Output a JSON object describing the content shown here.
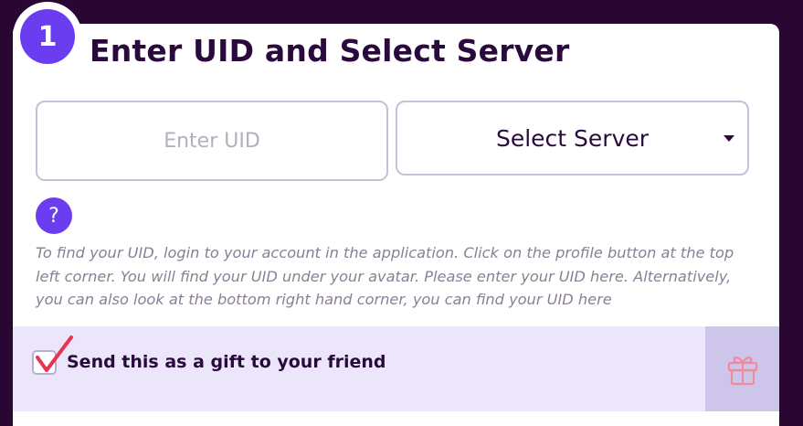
{
  "step": {
    "number": "1",
    "title": "Enter UID and Select Server"
  },
  "uid_field": {
    "value": "",
    "placeholder": "Enter UID"
  },
  "server_select": {
    "label": "Select Server"
  },
  "help": {
    "icon_label": "?",
    "text": "To find your UID, login to your account in the application. Click on the profile button at the top left corner. You will find your UID under your avatar. Please enter your UID here. Alternatively, you can also look at the bottom right hand corner, you can find your UID here"
  },
  "gift": {
    "label": "Send this as a gift to your friend",
    "checked": true,
    "icon": "gift-icon"
  },
  "colors": {
    "background": "#2a0733",
    "accent": "#6b3df0",
    "checkmark": "#e8344e",
    "gift_bar": "#ece6fb",
    "gift_button": "#cdc6ea"
  }
}
